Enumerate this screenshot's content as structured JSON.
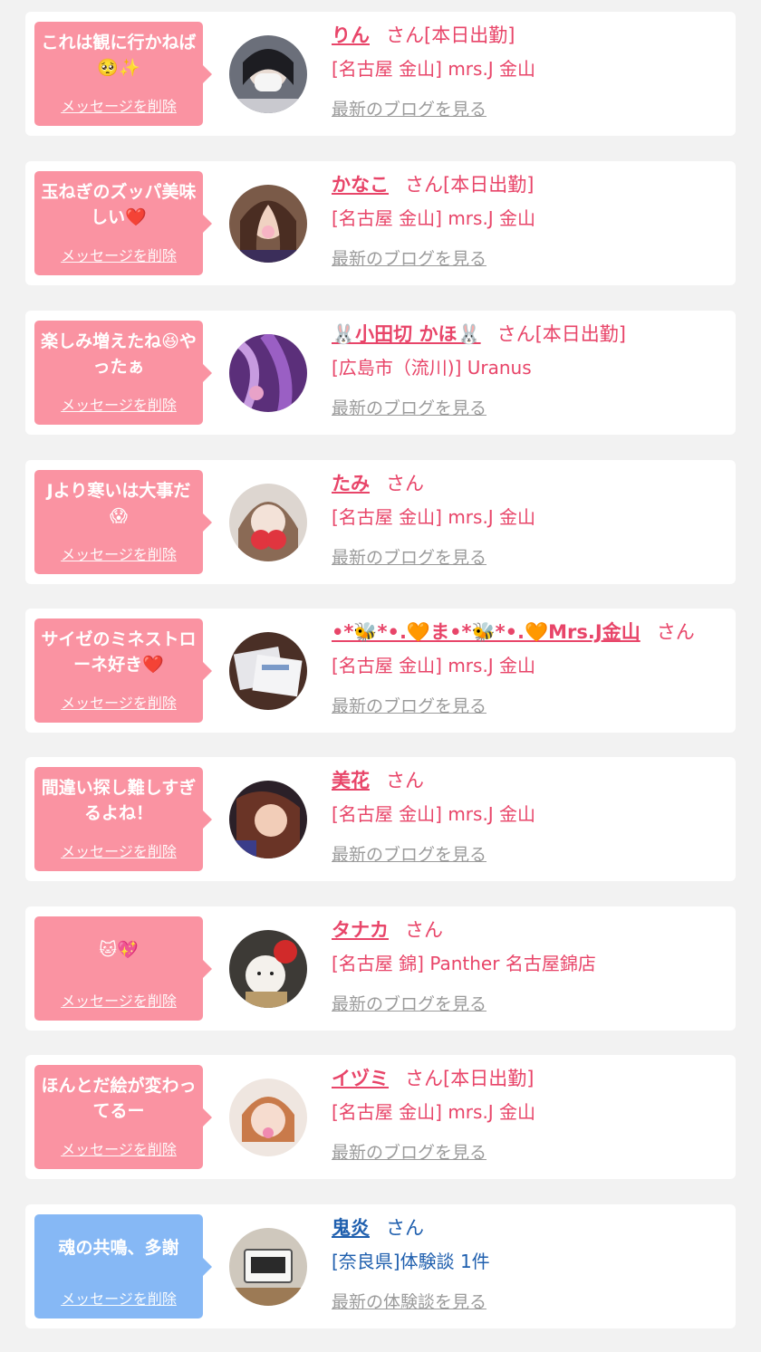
{
  "delete_label": "メッセージを削除",
  "suffix_san": "さん",
  "colors": {
    "pink_bubble": "#fa93a2",
    "blue_bubble": "#86b8f5",
    "pink_text": "#e84569",
    "blue_text": "#1f5fae"
  },
  "cards": [
    {
      "message": "これは観に行かねば🥺✨",
      "name": "りん",
      "status": "さん[本日出勤]",
      "shop": "[名古屋 金山] mrs.J 金山",
      "link": "最新のブログを見る"
    },
    {
      "message": "玉ねぎのズッパ美味しい❤️",
      "name": "かなこ",
      "status": "さん[本日出勤]",
      "shop": "[名古屋 金山] mrs.J 金山",
      "link": "最新のブログを見る"
    },
    {
      "message": "楽しみ増えたね😆やったぁ",
      "name": "🐰小田切 かほ🐰",
      "status": "さん[本日出勤]",
      "shop": "[広島市（流川)] Uranus",
      "link": "最新のブログを見る"
    },
    {
      "message": "Jより寒いは大事だ😱",
      "name": "たみ",
      "status": "さん",
      "shop": "[名古屋 金山] mrs.J 金山",
      "link": "最新のブログを見る"
    },
    {
      "message": "サイゼのミネストローネ好き❤️",
      "name": "•*🐝*•.🧡ま•*🐝*•.🧡Mrs.J金山",
      "status": "さん",
      "shop": "[名古屋 金山] mrs.J 金山",
      "link": "最新のブログを見る"
    },
    {
      "message": "間違い探し難しすぎるよね！",
      "name": "美花",
      "status": "さん",
      "shop": "[名古屋 金山] mrs.J 金山",
      "link": "最新のブログを見る"
    },
    {
      "message": "🐱💖",
      "name": "タナカ",
      "status": "さん",
      "shop": "[名古屋 錦] Panther 名古屋錦店",
      "link": "最新のブログを見る"
    },
    {
      "message": "ほんとだ絵が変わってるー",
      "name": "イヅミ",
      "status": "さん[本日出勤]",
      "shop": "[名古屋 金山] mrs.J 金山",
      "link": "最新のブログを見る"
    },
    {
      "message": "魂の共鳴、多謝",
      "name": "鬼炎",
      "status": "さん",
      "shop": "[奈良県]体験談 1件",
      "link": "最新の体験談を見る"
    }
  ]
}
